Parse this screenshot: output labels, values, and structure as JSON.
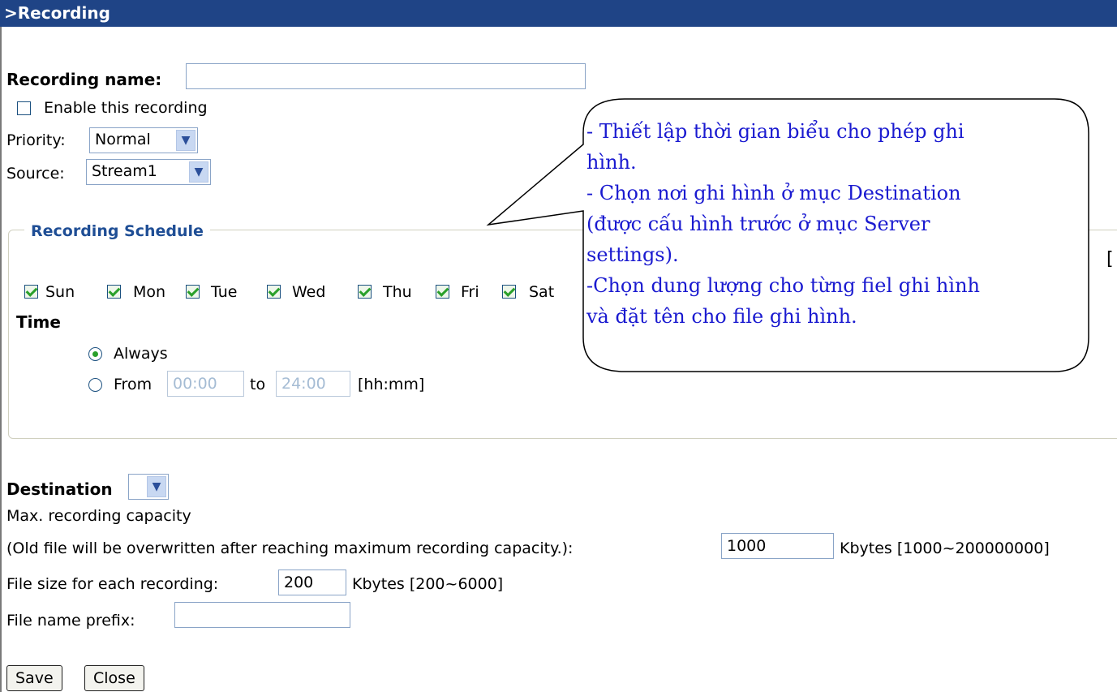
{
  "header": {
    "title": ">Recording"
  },
  "recording": {
    "name_label": "Recording name:",
    "name_value": "",
    "enable_label": "Enable this recording",
    "priority_label": "Priority:",
    "priority_value": "Normal",
    "source_label": "Source:",
    "source_value": "Stream1"
  },
  "schedule": {
    "legend": "Recording Schedule",
    "days": [
      {
        "label": "Sun",
        "checked": true
      },
      {
        "label": "Mon",
        "checked": true
      },
      {
        "label": "Tue",
        "checked": true
      },
      {
        "label": "Wed",
        "checked": true
      },
      {
        "label": "Thu",
        "checked": true
      },
      {
        "label": "Fri",
        "checked": true
      },
      {
        "label": "Sat",
        "checked": true
      }
    ],
    "time_label": "Time",
    "always_label": "Always",
    "from_label": "From",
    "from_value": "00:00",
    "to_label": "to",
    "to_value": "24:00",
    "unit_label": "[hh:mm]"
  },
  "destination": {
    "label": "Destination",
    "value": "",
    "max_capacity_label": "Max. recording capacity",
    "overwrite_label": "(Old file will be overwritten after reaching maximum recording capacity.):",
    "capacity_value": "1000",
    "capacity_unit": "Kbytes [1000~200000000]",
    "file_size_label": "File size for each recording:",
    "file_size_value": "200",
    "file_size_unit": "Kbytes [200~6000]",
    "prefix_label": "File name prefix:",
    "prefix_value": ""
  },
  "buttons": {
    "save": "Save",
    "close": "Close"
  },
  "callout": {
    "lines": [
      " - Thiết lập thời gian biểu cho phép ghi",
      "hình.",
      "- Chọn nơi ghi hình ở mục Destination",
      "(được cấu hình trước ở mục Server",
      "settings).",
      "-Chọn dung lượng cho từng fiel ghi hình",
      "và đặt tên cho file ghi hình."
    ]
  },
  "edge_mark": "["
}
